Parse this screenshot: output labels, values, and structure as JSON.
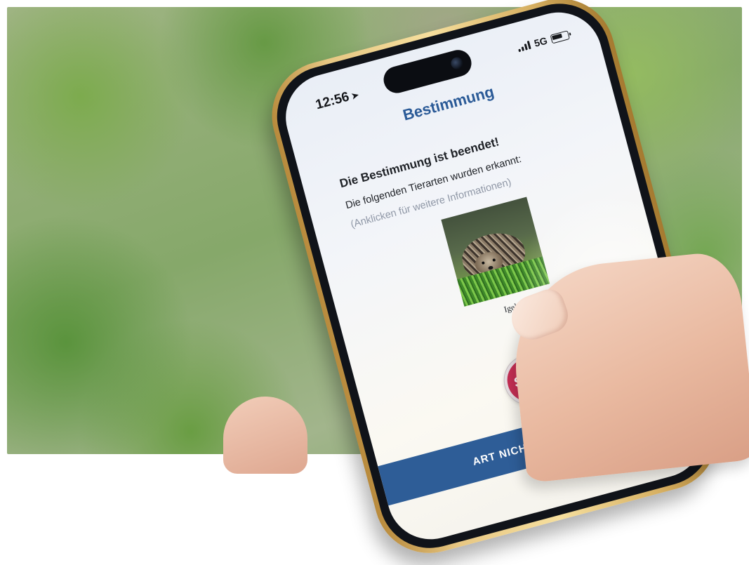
{
  "status_bar": {
    "time": "12:56",
    "location_icon": "location-arrow-icon",
    "network": "5G",
    "signal_icon": "signal-bars-icon",
    "battery_icon": "battery-icon"
  },
  "screen": {
    "title": "Bestimmung",
    "headline": "Die Bestimmung ist beendet!",
    "subline": "Die folgenden Tierarten wurden erkannt:",
    "hint": "(Anklicken für weitere Informationen)"
  },
  "results": [
    {
      "name": "Igel"
    }
  ],
  "sos_label": "SOS",
  "not_found_label": "ART NICHT GEFUNDEN?",
  "colors": {
    "accent": "#2e5d97",
    "sos": "#c82f55",
    "frame": "#e7c783"
  }
}
